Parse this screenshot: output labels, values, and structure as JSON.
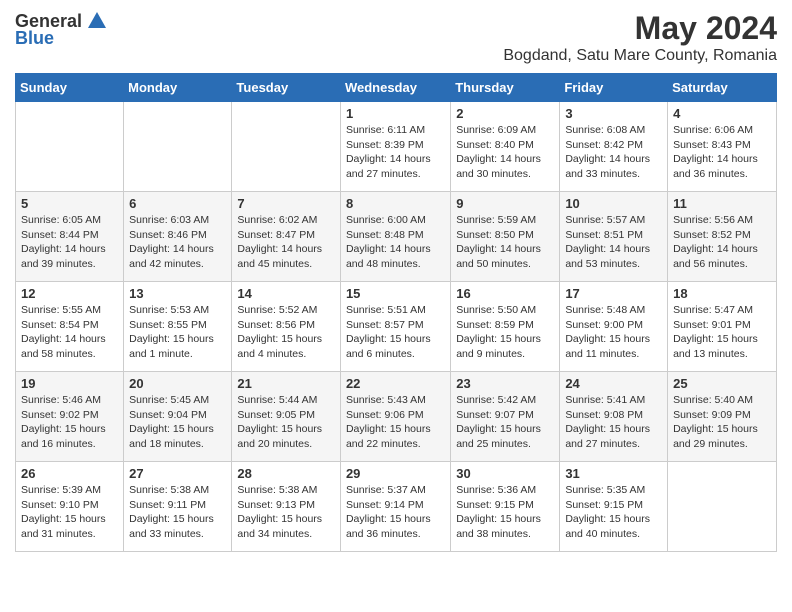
{
  "header": {
    "logo_general": "General",
    "logo_blue": "Blue",
    "month": "May 2024",
    "location": "Bogdand, Satu Mare County, Romania"
  },
  "days_of_week": [
    "Sunday",
    "Monday",
    "Tuesday",
    "Wednesday",
    "Thursday",
    "Friday",
    "Saturday"
  ],
  "weeks": [
    [
      {
        "day": "",
        "info": ""
      },
      {
        "day": "",
        "info": ""
      },
      {
        "day": "",
        "info": ""
      },
      {
        "day": "1",
        "info": "Sunrise: 6:11 AM\nSunset: 8:39 PM\nDaylight: 14 hours and 27 minutes."
      },
      {
        "day": "2",
        "info": "Sunrise: 6:09 AM\nSunset: 8:40 PM\nDaylight: 14 hours and 30 minutes."
      },
      {
        "day": "3",
        "info": "Sunrise: 6:08 AM\nSunset: 8:42 PM\nDaylight: 14 hours and 33 minutes."
      },
      {
        "day": "4",
        "info": "Sunrise: 6:06 AM\nSunset: 8:43 PM\nDaylight: 14 hours and 36 minutes."
      }
    ],
    [
      {
        "day": "5",
        "info": "Sunrise: 6:05 AM\nSunset: 8:44 PM\nDaylight: 14 hours and 39 minutes."
      },
      {
        "day": "6",
        "info": "Sunrise: 6:03 AM\nSunset: 8:46 PM\nDaylight: 14 hours and 42 minutes."
      },
      {
        "day": "7",
        "info": "Sunrise: 6:02 AM\nSunset: 8:47 PM\nDaylight: 14 hours and 45 minutes."
      },
      {
        "day": "8",
        "info": "Sunrise: 6:00 AM\nSunset: 8:48 PM\nDaylight: 14 hours and 48 minutes."
      },
      {
        "day": "9",
        "info": "Sunrise: 5:59 AM\nSunset: 8:50 PM\nDaylight: 14 hours and 50 minutes."
      },
      {
        "day": "10",
        "info": "Sunrise: 5:57 AM\nSunset: 8:51 PM\nDaylight: 14 hours and 53 minutes."
      },
      {
        "day": "11",
        "info": "Sunrise: 5:56 AM\nSunset: 8:52 PM\nDaylight: 14 hours and 56 minutes."
      }
    ],
    [
      {
        "day": "12",
        "info": "Sunrise: 5:55 AM\nSunset: 8:54 PM\nDaylight: 14 hours and 58 minutes."
      },
      {
        "day": "13",
        "info": "Sunrise: 5:53 AM\nSunset: 8:55 PM\nDaylight: 15 hours and 1 minute."
      },
      {
        "day": "14",
        "info": "Sunrise: 5:52 AM\nSunset: 8:56 PM\nDaylight: 15 hours and 4 minutes."
      },
      {
        "day": "15",
        "info": "Sunrise: 5:51 AM\nSunset: 8:57 PM\nDaylight: 15 hours and 6 minutes."
      },
      {
        "day": "16",
        "info": "Sunrise: 5:50 AM\nSunset: 8:59 PM\nDaylight: 15 hours and 9 minutes."
      },
      {
        "day": "17",
        "info": "Sunrise: 5:48 AM\nSunset: 9:00 PM\nDaylight: 15 hours and 11 minutes."
      },
      {
        "day": "18",
        "info": "Sunrise: 5:47 AM\nSunset: 9:01 PM\nDaylight: 15 hours and 13 minutes."
      }
    ],
    [
      {
        "day": "19",
        "info": "Sunrise: 5:46 AM\nSunset: 9:02 PM\nDaylight: 15 hours and 16 minutes."
      },
      {
        "day": "20",
        "info": "Sunrise: 5:45 AM\nSunset: 9:04 PM\nDaylight: 15 hours and 18 minutes."
      },
      {
        "day": "21",
        "info": "Sunrise: 5:44 AM\nSunset: 9:05 PM\nDaylight: 15 hours and 20 minutes."
      },
      {
        "day": "22",
        "info": "Sunrise: 5:43 AM\nSunset: 9:06 PM\nDaylight: 15 hours and 22 minutes."
      },
      {
        "day": "23",
        "info": "Sunrise: 5:42 AM\nSunset: 9:07 PM\nDaylight: 15 hours and 25 minutes."
      },
      {
        "day": "24",
        "info": "Sunrise: 5:41 AM\nSunset: 9:08 PM\nDaylight: 15 hours and 27 minutes."
      },
      {
        "day": "25",
        "info": "Sunrise: 5:40 AM\nSunset: 9:09 PM\nDaylight: 15 hours and 29 minutes."
      }
    ],
    [
      {
        "day": "26",
        "info": "Sunrise: 5:39 AM\nSunset: 9:10 PM\nDaylight: 15 hours and 31 minutes."
      },
      {
        "day": "27",
        "info": "Sunrise: 5:38 AM\nSunset: 9:11 PM\nDaylight: 15 hours and 33 minutes."
      },
      {
        "day": "28",
        "info": "Sunrise: 5:38 AM\nSunset: 9:13 PM\nDaylight: 15 hours and 34 minutes."
      },
      {
        "day": "29",
        "info": "Sunrise: 5:37 AM\nSunset: 9:14 PM\nDaylight: 15 hours and 36 minutes."
      },
      {
        "day": "30",
        "info": "Sunrise: 5:36 AM\nSunset: 9:15 PM\nDaylight: 15 hours and 38 minutes."
      },
      {
        "day": "31",
        "info": "Sunrise: 5:35 AM\nSunset: 9:15 PM\nDaylight: 15 hours and 40 minutes."
      },
      {
        "day": "",
        "info": ""
      }
    ]
  ]
}
